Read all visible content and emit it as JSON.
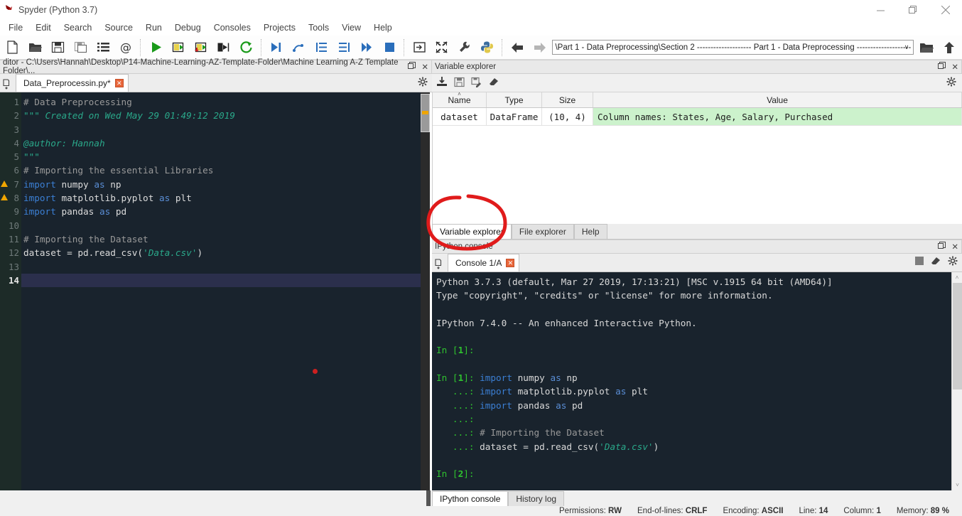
{
  "window": {
    "title": "Spyder (Python 3.7)",
    "minimize": "—",
    "maximize": "❐",
    "close": "✕"
  },
  "menubar": {
    "items": [
      "File",
      "Edit",
      "Search",
      "Source",
      "Run",
      "Debug",
      "Consoles",
      "Projects",
      "Tools",
      "View",
      "Help"
    ]
  },
  "toolbar": {
    "icons": [
      "new-file-icon",
      "open-file-icon",
      "save-file-icon",
      "save-all-icon",
      "file-list-icon",
      "at-symbol-icon",
      "run-file-icon",
      "run-cell-icon",
      "run-cell-advance-icon",
      "run-selection-icon",
      "re-run-icon",
      "debug-file-icon",
      "debug-step-icon",
      "debug-step-into-icon",
      "debug-step-return-icon",
      "debug-continue-icon",
      "debug-stop-icon",
      "maximize-pane-icon",
      "fullscreen-icon",
      "preferences-icon",
      "python-path-icon"
    ],
    "back_label": "back-arrow-icon",
    "forward_label": "forward-arrow-icon",
    "path_value": "\\Part 1 - Data Preprocessing\\Section 2 -------------------- Part 1 - Data Preprocessing --------------------",
    "dropdown_caret": "∨",
    "browse_label": "browse-folder-icon",
    "parent_label": "parent-directory-icon"
  },
  "editor": {
    "pane_title": "ditor - C:\\Users\\Hannah\\Desktop\\P14-Machine-Learning-AZ-Template-Folder\\Machine Learning A-Z Template Folder\\...",
    "undock_icon": "undock-icon",
    "close_icon": "✕",
    "browse_tabs_icon": "browse-tabs-icon",
    "options_icon": "options-gear-icon",
    "tab": {
      "label": "Data_Preprocessin.py*",
      "close": "✕"
    },
    "lines": [
      {
        "n": "1",
        "warn": false,
        "cur": false,
        "tokens": [
          {
            "t": "# Data Preprocessing",
            "c": "c-com"
          }
        ]
      },
      {
        "n": "2",
        "warn": false,
        "cur": false,
        "tokens": [
          {
            "t": "\"\"\" Created on Wed May 29 01:49:12 2019",
            "c": "c-str"
          }
        ]
      },
      {
        "n": "3",
        "warn": false,
        "cur": false,
        "tokens": [
          {
            "t": "",
            "c": "c-def"
          }
        ]
      },
      {
        "n": "4",
        "warn": false,
        "cur": false,
        "tokens": [
          {
            "t": "@author: Hannah",
            "c": "c-str"
          }
        ]
      },
      {
        "n": "5",
        "warn": false,
        "cur": false,
        "tokens": [
          {
            "t": "\"\"\"",
            "c": "c-str"
          }
        ]
      },
      {
        "n": "6",
        "warn": false,
        "cur": false,
        "tokens": [
          {
            "t": "# Importing the essential Libraries",
            "c": "c-com"
          }
        ]
      },
      {
        "n": "7",
        "warn": true,
        "cur": false,
        "tokens": [
          {
            "t": "import",
            "c": "c-kw"
          },
          {
            "t": " numpy ",
            "c": "c-def"
          },
          {
            "t": "as",
            "c": "c-kw2"
          },
          {
            "t": " np",
            "c": "c-def"
          }
        ]
      },
      {
        "n": "8",
        "warn": true,
        "cur": false,
        "tokens": [
          {
            "t": "import",
            "c": "c-kw"
          },
          {
            "t": " matplotlib.pyplot ",
            "c": "c-def"
          },
          {
            "t": "as",
            "c": "c-kw2"
          },
          {
            "t": " plt",
            "c": "c-def"
          }
        ]
      },
      {
        "n": "9",
        "warn": false,
        "cur": false,
        "tokens": [
          {
            "t": "import",
            "c": "c-kw"
          },
          {
            "t": " pandas ",
            "c": "c-def"
          },
          {
            "t": "as",
            "c": "c-kw2"
          },
          {
            "t": " pd",
            "c": "c-def"
          }
        ]
      },
      {
        "n": "10",
        "warn": false,
        "cur": false,
        "tokens": [
          {
            "t": "",
            "c": "c-def"
          }
        ]
      },
      {
        "n": "11",
        "warn": false,
        "cur": false,
        "tokens": [
          {
            "t": "# Importing the Dataset",
            "c": "c-com"
          }
        ]
      },
      {
        "n": "12",
        "warn": false,
        "cur": false,
        "tokens": [
          {
            "t": "dataset = pd.read_csv(",
            "c": "c-def"
          },
          {
            "t": "'Data.csv'",
            "c": "c-str"
          },
          {
            "t": ")",
            "c": "c-def"
          }
        ]
      },
      {
        "n": "13",
        "warn": false,
        "cur": false,
        "tokens": [
          {
            "t": "",
            "c": "c-def"
          }
        ]
      },
      {
        "n": "14",
        "warn": false,
        "cur": true,
        "tokens": [
          {
            "t": "",
            "c": "c-def"
          }
        ]
      }
    ]
  },
  "variable_explorer": {
    "pane_title": "Variable explorer",
    "undock_icon": "undock-icon",
    "close_icon": "✕",
    "toolbar_icons": [
      "import-data-icon",
      "save-data-icon",
      "save-data-as-icon",
      "remove-all-icon"
    ],
    "options_icon": "options-gear-icon",
    "columns": [
      "Name",
      "Type",
      "Size",
      "Value"
    ],
    "sort_caret": "˄",
    "rows": [
      {
        "name": "dataset",
        "type": "DataFrame",
        "size": "(10, 4)",
        "value": "Column names: States, Age, Salary, Purchased"
      }
    ],
    "tabs": [
      {
        "label": "Variable explorer",
        "active": true
      },
      {
        "label": "File explorer",
        "active": false
      },
      {
        "label": "Help",
        "active": false
      }
    ]
  },
  "console": {
    "pane_title": "IPython console",
    "undock_icon": "undock-icon",
    "close_icon": "✕",
    "new_console_icon": "new-console-icon",
    "tab": {
      "label": "Console 1/A",
      "close": "✕"
    },
    "tools": [
      "stop-icon",
      "remove-all-icon",
      "options-gear-icon"
    ],
    "lines": [
      [
        {
          "t": "Python 3.7.3 (default, Mar 27 2019, 17:13:21) [MSC v.1915 64 bit (AMD64)]",
          "c": ""
        }
      ],
      [
        {
          "t": "Type \"copyright\", \"credits\" or \"license\" for more information.",
          "c": ""
        }
      ],
      [
        {
          "t": "",
          "c": ""
        }
      ],
      [
        {
          "t": "IPython 7.4.0 -- An enhanced Interactive Python.",
          "c": ""
        }
      ],
      [
        {
          "t": "",
          "c": ""
        }
      ],
      [
        {
          "t": "In [",
          "c": "p-in"
        },
        {
          "t": "1",
          "c": "p-num"
        },
        {
          "t": "]:",
          "c": "p-in"
        }
      ],
      [
        {
          "t": "",
          "c": ""
        }
      ],
      [
        {
          "t": "In [",
          "c": "p-in"
        },
        {
          "t": "1",
          "c": "p-num"
        },
        {
          "t": "]: ",
          "c": "p-in"
        },
        {
          "t": "import",
          "c": "c-kw"
        },
        {
          "t": " numpy ",
          "c": ""
        },
        {
          "t": "as",
          "c": "c-kw2"
        },
        {
          "t": " np",
          "c": ""
        }
      ],
      [
        {
          "t": "   ...: ",
          "c": "p-in"
        },
        {
          "t": "import",
          "c": "c-kw"
        },
        {
          "t": " matplotlib.pyplot ",
          "c": ""
        },
        {
          "t": "as",
          "c": "c-kw2"
        },
        {
          "t": " plt",
          "c": ""
        }
      ],
      [
        {
          "t": "   ...: ",
          "c": "p-in"
        },
        {
          "t": "import",
          "c": "c-kw"
        },
        {
          "t": " pandas ",
          "c": ""
        },
        {
          "t": "as",
          "c": "c-kw2"
        },
        {
          "t": " pd",
          "c": ""
        }
      ],
      [
        {
          "t": "   ...: ",
          "c": "p-in"
        }
      ],
      [
        {
          "t": "   ...: ",
          "c": "p-in"
        },
        {
          "t": "# Importing the Dataset",
          "c": "c-com"
        }
      ],
      [
        {
          "t": "   ...: ",
          "c": "p-in"
        },
        {
          "t": "dataset = pd.read_csv(",
          "c": ""
        },
        {
          "t": "'Data.csv'",
          "c": "c-str"
        },
        {
          "t": ")",
          "c": ""
        }
      ],
      [
        {
          "t": "",
          "c": ""
        }
      ],
      [
        {
          "t": "In [",
          "c": "p-in"
        },
        {
          "t": "2",
          "c": "p-num"
        },
        {
          "t": "]:",
          "c": "p-in"
        }
      ]
    ],
    "scroll_up": "˄",
    "scroll_down": "˅"
  },
  "bottom_tabs": [
    {
      "label": "IPython console",
      "active": true
    },
    {
      "label": "History log",
      "active": false
    }
  ],
  "statusbar": [
    {
      "label": "Permissions:",
      "value": "RW"
    },
    {
      "label": "End-of-lines:",
      "value": "CRLF"
    },
    {
      "label": "Encoding:",
      "value": "ASCII"
    },
    {
      "label": "Line:",
      "value": "14"
    },
    {
      "label": "Column:",
      "value": "1"
    },
    {
      "label": "Memory:",
      "value": "89 %"
    }
  ],
  "annotations": {
    "circle": {
      "name": "red-ink-circle",
      "color": "#e01b1b"
    },
    "dot": {
      "name": "red-cursor-dot",
      "color": "#cc2020"
    }
  }
}
